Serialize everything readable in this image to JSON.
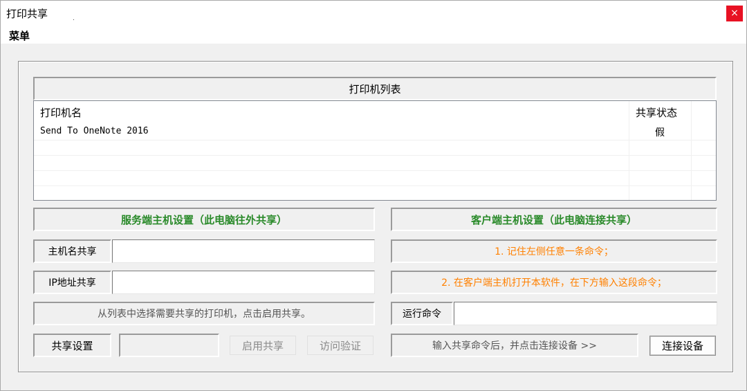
{
  "window": {
    "title": "打印共享",
    "title_mark": ".",
    "close_label": "×"
  },
  "menubar": {
    "menu_label": "菜单"
  },
  "printer_list": {
    "title": "打印机列表",
    "columns": [
      "打印机名",
      "共享状态"
    ],
    "rows": [
      {
        "name": "Send To OneNote 2016",
        "shared": "假"
      }
    ]
  },
  "server": {
    "title": "服务端主机设置（此电脑往外共享）",
    "hostname_label": "主机名共享",
    "hostname_value": "",
    "ip_label": "IP地址共享",
    "ip_value": "",
    "hint": "从列表中选择需要共享的打印机，点击启用共享。",
    "share_settings_label": "共享设置",
    "share_settings_value": "",
    "enable_share_button": "启用共享",
    "access_verify_button": "访问验证"
  },
  "client": {
    "title": "客户端主机设置（此电脑连接共享）",
    "step1": "1. 记住左侧任意一条命令；",
    "step2": "2. 在客户端主机打开本软件，在下方输入这段命令；",
    "run_command_label": "运行命令",
    "run_command_value": "",
    "connect_hint": "输入共享命令后，并点击连接设备 >>",
    "connect_button": "连接设备"
  },
  "colors": {
    "green_title": "#2a8a2a",
    "orange_text": "#ff8000",
    "close_red": "#e81123"
  }
}
